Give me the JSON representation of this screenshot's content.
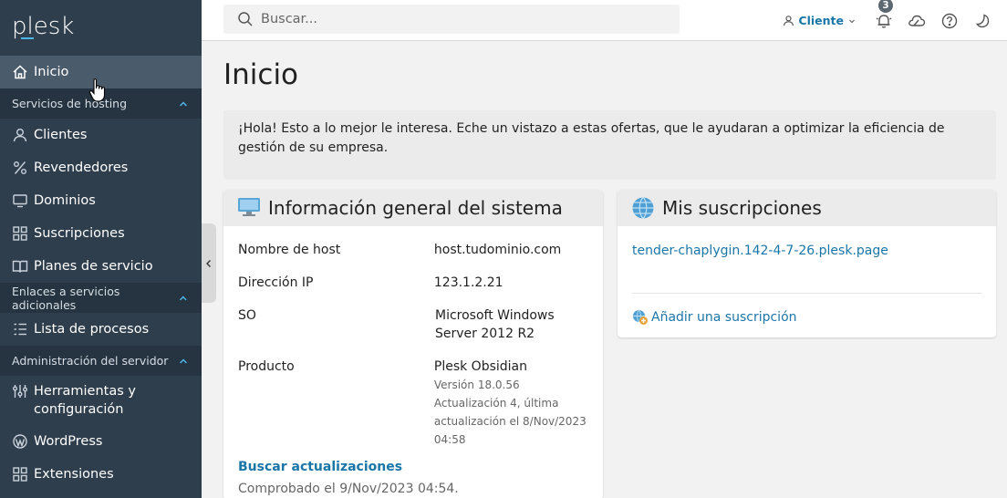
{
  "brand": {
    "logo_text": "plesk",
    "accent": "#4db6e8"
  },
  "sidebar": {
    "items": [
      {
        "label": "Inicio",
        "icon": "home-icon"
      },
      {
        "group": "Servicios de hosting"
      },
      {
        "label": "Clientes",
        "icon": "user-icon"
      },
      {
        "label": "Revendedores",
        "icon": "percent-icon"
      },
      {
        "label": "Dominios",
        "icon": "monitor-icon"
      },
      {
        "label": "Suscripciones",
        "icon": "grid-icon"
      },
      {
        "label": "Planes de servicio",
        "icon": "book-icon"
      },
      {
        "group": "Enlaces a servicios adicionales"
      },
      {
        "label": "Lista de procesos",
        "icon": "list-icon"
      },
      {
        "group": "Administración del servidor"
      },
      {
        "label": "Herramientas y configuración",
        "icon": "sliders-icon"
      },
      {
        "label": "WordPress",
        "icon": "wordpress-icon"
      },
      {
        "label": "Extensiones",
        "icon": "extensions-icon"
      }
    ]
  },
  "topbar": {
    "search_placeholder": "Buscar...",
    "user_label": "Cliente",
    "notifications_count": "3"
  },
  "main": {
    "title": "Inicio",
    "hello_text": "¡Hola! Esto a lo mejor le interesa. Eche un vistazo a estas ofertas, que le ayudaran a optimizar la eficiencia de gestión de su empresa."
  },
  "system": {
    "title": "Información general del sistema",
    "rows": [
      {
        "k": "Nombre de host",
        "v": "host.tudominio.com"
      },
      {
        "k": "Dirección IP",
        "v": "123.1.2.21"
      },
      {
        "k": "SO",
        "v": "Microsoft Windows Server 2012 R2"
      },
      {
        "k": "Producto",
        "v": "Plesk Obsidian"
      }
    ],
    "product_note": "Versión 18.0.56 Actualización 4, última actualización el 8/Nov/2023 04:58",
    "check_updates": "Buscar actualizaciones",
    "checked": "Comprobado el 9/Nov/2023 04:54."
  },
  "subscriptions": {
    "title": "Mis suscripciones",
    "link": "tender-chaplygin.142-4-7-26.plesk.page",
    "add": "Añadir una suscripción"
  }
}
